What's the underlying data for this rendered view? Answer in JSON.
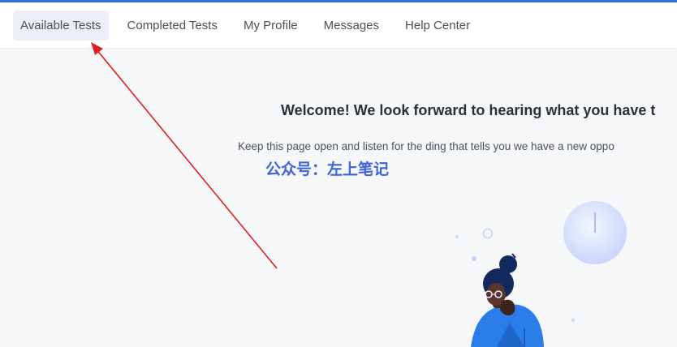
{
  "nav": {
    "items": [
      {
        "label": "Available Tests",
        "active": true
      },
      {
        "label": "Completed Tests",
        "active": false
      },
      {
        "label": "My Profile",
        "active": false
      },
      {
        "label": "Messages",
        "active": false
      },
      {
        "label": "Help Center",
        "active": false
      }
    ]
  },
  "main": {
    "welcome_title": "Welcome! We look forward to hearing what you have t",
    "subtitle": "Keep this page open and listen for the ding that tells you we have a new oppo",
    "watermark_text": "公众号：左上笔记"
  },
  "colors": {
    "accent_strip": "#2f6de1",
    "annotation_arrow": "#e02020",
    "watermark": "#3f63d8",
    "illustration_shirt": "#2b7de9"
  },
  "icons": {
    "arrow": "red-annotation-arrow",
    "illustration": "woman-thinking-illustration"
  }
}
